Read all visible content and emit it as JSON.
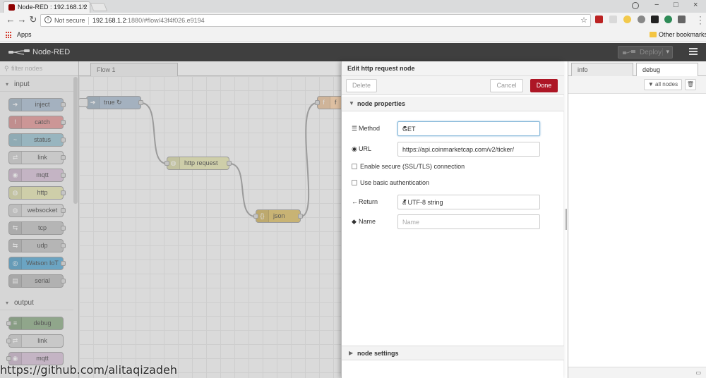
{
  "browser": {
    "tab_title": "Node-RED : 192.168.1.2",
    "tab_close": "×",
    "back": "←",
    "forward": "→",
    "reload": "↻",
    "security_label": "Not secure",
    "url_host": "192.168.1.2",
    "url_rest": ":1880/#flow/43f4f026.e9194",
    "star": "☆",
    "minimize": "−",
    "maximize": "□",
    "close": "×",
    "bookmarks": {
      "apps_label": "Apps",
      "other_label": "Other bookmarks"
    }
  },
  "header": {
    "title": "Node-RED",
    "deploy_label": "Deploy",
    "deploy_caret": "▾"
  },
  "palette": {
    "search_placeholder": "filter nodes",
    "categories": [
      {
        "label": "input",
        "caret": "▾"
      },
      {
        "label": "output",
        "caret": "▾"
      }
    ],
    "input_nodes": [
      {
        "label": "inject",
        "color": "#a6bbcf",
        "icon": "➔"
      },
      {
        "label": "catch",
        "color": "#e49191",
        "icon": "!"
      },
      {
        "label": "status",
        "color": "#94c1d0",
        "icon": "~"
      },
      {
        "label": "link",
        "color": "#dddddd",
        "icon": "⇄"
      },
      {
        "label": "mqtt",
        "color": "#d8bfd8",
        "icon": "◉"
      },
      {
        "label": "http",
        "color": "#e7e7ae",
        "icon": "◍"
      },
      {
        "label": "websocket",
        "color": "#dddddd",
        "icon": "◍"
      },
      {
        "label": "tcp",
        "color": "#c0c0c0",
        "icon": "⇆"
      },
      {
        "label": "udp",
        "color": "#c0c0c0",
        "icon": "⇆"
      },
      {
        "label": "Watson IoT",
        "color": "#4fa6d4",
        "icon": "◎"
      },
      {
        "label": "serial",
        "color": "#bbbbbb",
        "icon": "▤"
      }
    ],
    "output_nodes": [
      {
        "label": "debug",
        "color": "#87a980",
        "icon": "≡"
      },
      {
        "label": "link",
        "color": "#dddddd",
        "icon": "⇄"
      },
      {
        "label": "mqtt",
        "color": "#d8bfd8",
        "icon": "◉"
      }
    ]
  },
  "workspace": {
    "tab_label": "Flow 1",
    "nodes": [
      {
        "label": "true ↻",
        "color": "#a6bbcf",
        "icon": "➔"
      },
      {
        "label": "http request",
        "color": "#e7e7ae",
        "icon": "◍"
      },
      {
        "label": "json",
        "color": "#debd5c",
        "icon": "{}"
      },
      {
        "label": "f",
        "color": "#fdd0a2",
        "icon": "f"
      }
    ]
  },
  "tray": {
    "title": "Edit http request node",
    "delete_label": "Delete",
    "cancel_label": "Cancel",
    "done_label": "Done",
    "properties_header": "node properties",
    "settings_header": "node settings",
    "method_label": "Method",
    "method_value": "GET",
    "url_label": "URL",
    "url_value": "https://api.coinmarketcap.com/v2/ticker/",
    "tls_label": "Enable secure (SSL/TLS) connection",
    "basic_auth_label": "Use basic authentication",
    "return_label": "Return",
    "return_value": "a UTF-8 string",
    "name_label": "Name",
    "name_placeholder": "Name",
    "colors": {
      "done": "#ad1625"
    }
  },
  "sidebar": {
    "tab_info": "info",
    "tab_debug": "debug",
    "filter_label": "all nodes"
  },
  "watermark": "https://github.com/alitaqizadeh"
}
